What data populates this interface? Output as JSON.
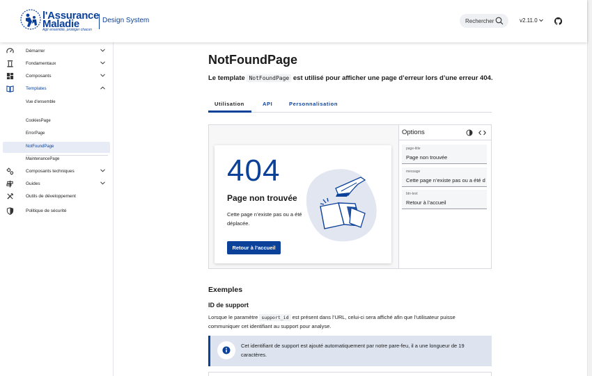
{
  "header": {
    "logo_line1": "l'Assurance",
    "logo_line2": "Maladie",
    "logo_tagline": "Agir ensemble, protéger chacun",
    "design_system_label": "Design System",
    "search_label": "Rechercher",
    "version": "v2.11.0"
  },
  "sidebar": {
    "items": [
      {
        "label": "Démarrer",
        "icon": "gauge-icon"
      },
      {
        "label": "Fondamentaux",
        "icon": "pillar-icon"
      },
      {
        "label": "Composants",
        "icon": "grid-icon"
      },
      {
        "label": "Templates",
        "icon": "book-icon"
      },
      {
        "label": "Composants techniques",
        "icon": "gears-icon"
      },
      {
        "label": "Guides",
        "icon": "signpost-icon"
      },
      {
        "label": "Outils de développement",
        "icon": "tools-icon"
      },
      {
        "label": "Politique de sécurité",
        "icon": "shield-icon"
      }
    ],
    "templates_children": [
      "Vue d'ensemble",
      "CookiesPage",
      "ErrorPage",
      "NotFoundPage",
      "MaintenancePage"
    ]
  },
  "main": {
    "title": "NotFoundPage",
    "intro_before": "Le template ",
    "intro_code": "NotFoundPage",
    "intro_after": " est utilisé pour afficher une page d’erreur lors d’une erreur 404.",
    "tabs": [
      "Utilisation",
      "API",
      "Personnalisation"
    ],
    "card": {
      "code": "404",
      "title": "Page non trouvée",
      "message": "Cette page n’existe pas ou a été déplacée.",
      "button": "Retour à l’accueil"
    },
    "options": {
      "title": "Options",
      "fields": [
        {
          "label": "page-title",
          "value": "Page non trouvée"
        },
        {
          "label": "message",
          "value": "Cette page n’existe pas ou a été d"
        },
        {
          "label": "btn-text",
          "value": "Retour à l’accueil"
        }
      ]
    },
    "examples_title": "Exemples",
    "support_title": "ID de support",
    "support_text_before": "Lorsque le paramètre ",
    "support_code": "support_id",
    "support_text_after": " est présent dans l’URL, celui-ci sera affiché afin que l’utilisateur puisse communiquer cet identifiant au support pour analyse.",
    "alert_text": "Cet identifiant de support est ajouté automatiquement par notre pare-feu, il a une longueur de 19 caractères."
  },
  "colors": {
    "brand": "#0c419a",
    "alert_bg": "#dde4f0"
  }
}
